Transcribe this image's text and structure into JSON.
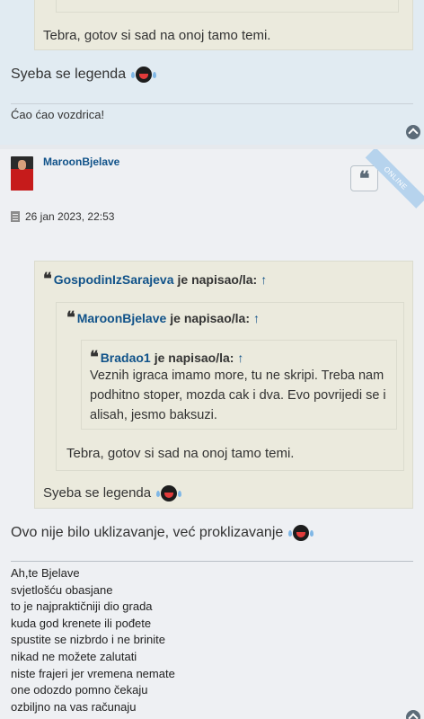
{
  "prev_post": {
    "quote_text": "Tebra, gotov si sad na onoj tamo temi.",
    "reply_text": "Syeba se legenda",
    "signature": "Ćao ćao vozdrica!"
  },
  "post": {
    "author": "MaroonBjelave",
    "online_badge": "ONLINE",
    "date": "26 jan 2023, 22:53",
    "quote_icon": "quote-icon",
    "quotes": [
      {
        "author": "GospodinIzSarajeva",
        "says": "je napisao/la:",
        "arrow": "↑"
      },
      {
        "author": "MaroonBjelave",
        "says": "je napisao/la:",
        "arrow": "↑"
      },
      {
        "author": "Bradao1",
        "says": "je napisao/la:",
        "arrow": "↑",
        "text": "Veznih igraca imamo more, tu ne skripi. Treba nam podhitno stoper, mozda cak i dva. Evo povrijedi se i alisah, jesmo baksuzi."
      }
    ],
    "quote2_text": "Tebra, gotov si sad na onoj tamo temi.",
    "quote1_text": "Syeba se legenda",
    "body_text": "Ovo nije bilo uklizavanje, već proklizavanje",
    "signature_lines": [
      "Ah,te Bjelave",
      "svjetlošću obasjane",
      "to je najpraktičniji dio grada",
      "kuda god krenete ili pođete",
      "spustite se nizbrdo i ne brinite",
      "nikad ne možete zalutati",
      "niste frajeri jer vremena nemate",
      "one odozdo pomno čekaju",
      "ozbiljno na vas računaju"
    ]
  },
  "colors": {
    "link": "#105289",
    "quote_bg": "#ebeadd",
    "online_ribbon": "#b6d3ed"
  }
}
